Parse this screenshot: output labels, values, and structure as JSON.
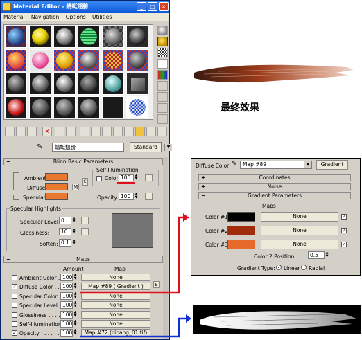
{
  "window": {
    "title": "Material Editor - 蜻蜓翅膀",
    "controls": {
      "minimize": "_",
      "maximize": "□",
      "close": "×"
    }
  },
  "menu": [
    "Material",
    "Navigation",
    "Options",
    "Utilities"
  ],
  "material_bar": {
    "name": "蜻蜓翅膀",
    "type_button": "Standard"
  },
  "blinn": {
    "header": "Blinn Basic Parameters",
    "ambient_label": "Ambient:",
    "diffuse_label": "Diffuse:",
    "specular_label": "Specular:",
    "map_letter": "M",
    "lock_letter": "C",
    "self_illum": {
      "group": "Self-Illumination",
      "color_label": "Color",
      "value": "100"
    },
    "opacity_label": "Opacity:",
    "opacity_value": "100",
    "highlights": {
      "group": "Specular Highlights",
      "level_label": "Specular Level:",
      "level": "0",
      "gloss_label": "Glossiness:",
      "gloss": "10",
      "soften_label": "Soften:",
      "soften": "0.1"
    }
  },
  "maps": {
    "header": "Maps",
    "col_amount": "Amount",
    "col_map": "Map",
    "rows": [
      {
        "label": "Ambient Color . . .",
        "checked": false,
        "amount": "100",
        "map": "None"
      },
      {
        "label": "Diffuse Color . . .",
        "checked": true,
        "amount": "100",
        "map": "Map #89  ( Gradient )"
      },
      {
        "label": "Specular Color . .",
        "checked": false,
        "amount": "100",
        "map": "None"
      },
      {
        "label": "Specular Level . .",
        "checked": false,
        "amount": "100",
        "map": "None"
      },
      {
        "label": "Glossiness . . . . .",
        "checked": false,
        "amount": "100",
        "map": "None"
      },
      {
        "label": "Self-Illumination .",
        "checked": false,
        "amount": "100",
        "map": "None"
      },
      {
        "label": "Opacity . . . . . . . .",
        "checked": true,
        "amount": "100",
        "map": "Map #72 (cibang_01.tif)"
      }
    ],
    "lock_letter": "B"
  },
  "effect_caption": "最终效果",
  "gradient_panel": {
    "diffuse_label": "Diffuse Color:",
    "map_name": "Map #89",
    "type_button": "Gradient",
    "coordinates": "Coordinates",
    "noise": "Noise",
    "gradient_params": "Gradient Parameters",
    "maps_label": "Maps",
    "colors": [
      {
        "label": "Color #1",
        "hex": "#000000",
        "map": "None",
        "checked": true
      },
      {
        "label": "Color #2",
        "hex": "#a02c0a",
        "map": "None",
        "checked": true
      },
      {
        "label": "Color #3",
        "hex": "#e66a2a",
        "map": "None",
        "checked": true
      }
    ],
    "color2_position_label": "Color 2 Position:",
    "color2_position": "0.5",
    "gradient_type_label": "Gradient Type:",
    "type_options": [
      "Linear",
      "Radial"
    ],
    "selected_type": "Linear"
  },
  "swatch_colors": {
    "ambient": "#e8792e",
    "diffuse": "#e8792e",
    "specular": "#e8792e",
    "highlight": "#747474"
  },
  "annotation_colors": {
    "red": "#e0101a",
    "blue": "#1030d0"
  }
}
